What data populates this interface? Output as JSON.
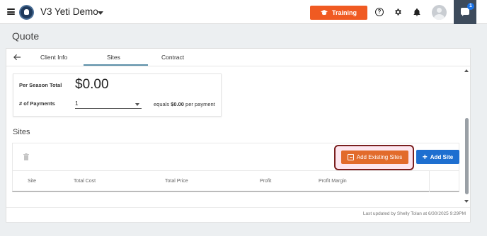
{
  "header": {
    "app_title": "V3 Yeti Demo",
    "training_label": "Training",
    "help_glyph": "?",
    "chat_badge": "1",
    "brand_color": "#f05a22"
  },
  "page": {
    "title": "Quote"
  },
  "tabs": [
    {
      "label": "Client Info",
      "active": false
    },
    {
      "label": "Sites",
      "active": true
    },
    {
      "label": "Contract",
      "active": false
    }
  ],
  "totals": {
    "per_season_label": "Per Season Total",
    "per_season_value": "$0.00",
    "payments_label": "# of Payments",
    "payments_value": "1",
    "equals_prefix": "equals ",
    "equals_amount": "$0.00",
    "equals_suffix": " per payment"
  },
  "sites": {
    "heading": "Sites",
    "add_existing_label": "Add Existing Sites",
    "add_site_label": "Add Site",
    "add_site_color": "#1e6fd0",
    "columns": [
      "Site",
      "Total Cost",
      "Total Price",
      "Profit",
      "Profit Margin"
    ]
  },
  "footer": {
    "last_updated": "Last updated by Shelly Tolan at 6/30/2025 9:29PM"
  }
}
